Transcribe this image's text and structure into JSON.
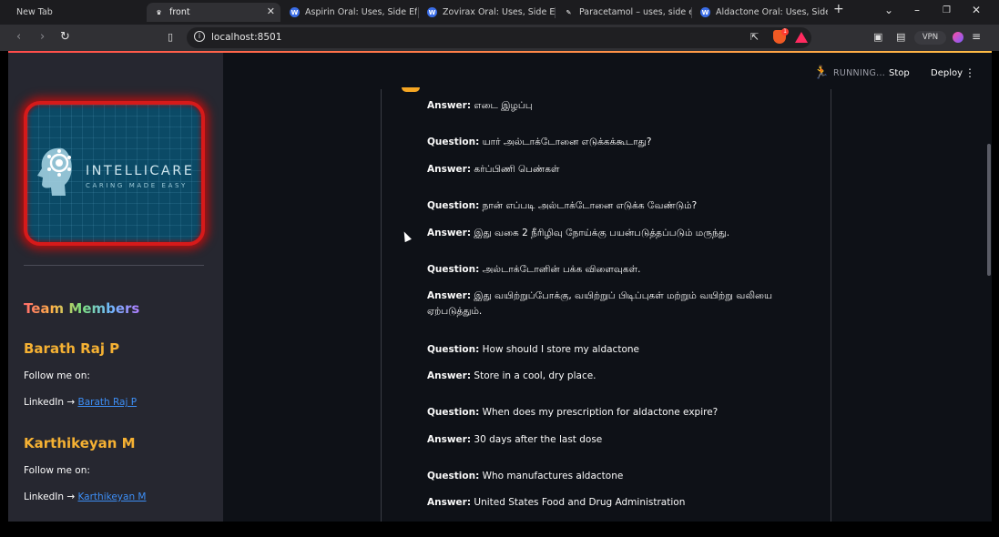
{
  "browser": {
    "tabs": [
      {
        "title": "New Tab",
        "icon": "none"
      },
      {
        "title": "front",
        "icon": "streamlit-icon",
        "active": true
      },
      {
        "title": "Aspirin Oral: Uses, Side Effects, ",
        "icon": "webmd-icon"
      },
      {
        "title": "Zovirax Oral: Uses, Side Effects, ",
        "icon": "webmd-icon"
      },
      {
        "title": "Paracetamol – uses, side effects",
        "icon": "paracetamol-icon"
      },
      {
        "title": "Aldactone Oral: Uses, Side Effec",
        "icon": "webmd-icon"
      }
    ],
    "url": "localhost:8501",
    "vpn_label": "VPN",
    "shield_badge": "1"
  },
  "sidebar": {
    "logo": {
      "title": "INTELLICARE",
      "tagline": "CARING MADE EASY"
    },
    "team_title": "Team Members",
    "members": [
      {
        "name": "Barath Raj P",
        "follow": "Follow me on:",
        "linkedin_prefix": "LinkedIn → ",
        "link_text": "Barath Raj P"
      },
      {
        "name": "Karthikeyan M",
        "follow": "Follow me on:",
        "linkedin_prefix": "LinkedIn → ",
        "link_text": "Karthikeyan M"
      }
    ]
  },
  "header": {
    "status": "RUNNING...",
    "stop_label": "Stop",
    "deploy_label": "Deploy"
  },
  "chat": {
    "question_label": "Question:",
    "answer_label": "Answer:",
    "items": [
      {
        "kind": "a",
        "text": "எடை இழப்பு"
      },
      {
        "kind": "q",
        "text": "யார் அல்டாக்டோனை எடுக்கக்கூடாது?"
      },
      {
        "kind": "a",
        "text": "கர்ப்பிணி பெண்கள்"
      },
      {
        "kind": "q",
        "text": "நான் எப்படி அல்டாக்டோனை எடுக்க வேண்டும்?"
      },
      {
        "kind": "a",
        "text": "இது வகை 2 நீரிழிவு நோய்க்கு பயன்படுத்தப்படும் மருந்து."
      },
      {
        "kind": "q",
        "text": "அல்டாக்டோனின் பக்க விளைவுகள்."
      },
      {
        "kind": "a",
        "text": "இது வயிற்றுப்போக்கு, வயிற்றுப் பிடிப்புகள் மற்றும் வயிற்று வலியை ஏற்படுத்தும்."
      },
      {
        "kind": "q",
        "text": "How should I store my aldactone"
      },
      {
        "kind": "a",
        "text": "Store in a cool, dry place."
      },
      {
        "kind": "q",
        "text": "When does my prescription for aldactone expire?"
      },
      {
        "kind": "a",
        "text": "30 days after the last dose"
      },
      {
        "kind": "q",
        "text": "Who manufactures aldactone"
      },
      {
        "kind": "a",
        "text": "United States Food and Drug Administration"
      }
    ]
  }
}
